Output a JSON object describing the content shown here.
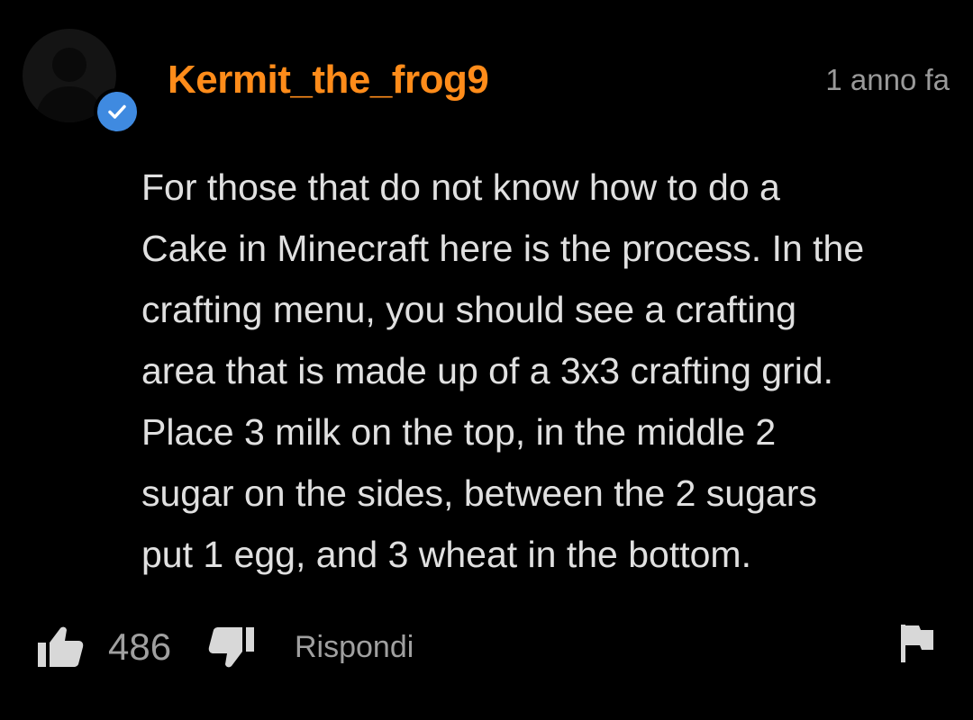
{
  "comment": {
    "username": "Kermit_the_frog9",
    "verified": true,
    "timestamp": "1 anno fa",
    "text_lines": [
      "For those that do not know how to do a",
      "Cake in Minecraft here is the process. In the",
      "crafting menu, you should see a crafting",
      "area that is made up of a 3x3 crafting grid.",
      "Place 3 milk on the top, in the middle 2",
      "sugar on the sides, between the 2 sugars",
      "put 1 egg, and 3 wheat in the bottom."
    ],
    "likes": "486",
    "reply_label": "Rispondi"
  },
  "icons": {
    "avatar": "default-user-avatar-icon",
    "verified_badge": "checkmark-icon",
    "like": "thumbs-up-icon",
    "dislike": "thumbs-down-icon",
    "report": "flag-icon"
  },
  "colors": {
    "background": "#000000",
    "username": "#ff8c1a",
    "body_text": "#e0e0e0",
    "secondary_text": "#9a9a9a",
    "verified_badge": "#3f8ae0"
  }
}
